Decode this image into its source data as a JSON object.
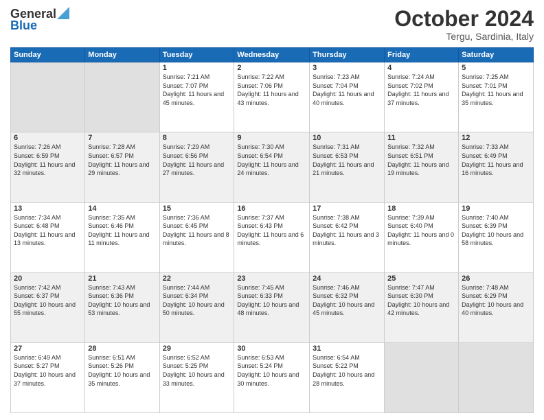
{
  "header": {
    "logo_general": "General",
    "logo_blue": "Blue",
    "month_title": "October 2024",
    "subtitle": "Tergu, Sardinia, Italy"
  },
  "days_of_week": [
    "Sunday",
    "Monday",
    "Tuesday",
    "Wednesday",
    "Thursday",
    "Friday",
    "Saturday"
  ],
  "weeks": [
    [
      {
        "day": "",
        "info": ""
      },
      {
        "day": "",
        "info": ""
      },
      {
        "day": "1",
        "info": "Sunrise: 7:21 AM\nSunset: 7:07 PM\nDaylight: 11 hours and 45 minutes."
      },
      {
        "day": "2",
        "info": "Sunrise: 7:22 AM\nSunset: 7:06 PM\nDaylight: 11 hours and 43 minutes."
      },
      {
        "day": "3",
        "info": "Sunrise: 7:23 AM\nSunset: 7:04 PM\nDaylight: 11 hours and 40 minutes."
      },
      {
        "day": "4",
        "info": "Sunrise: 7:24 AM\nSunset: 7:02 PM\nDaylight: 11 hours and 37 minutes."
      },
      {
        "day": "5",
        "info": "Sunrise: 7:25 AM\nSunset: 7:01 PM\nDaylight: 11 hours and 35 minutes."
      }
    ],
    [
      {
        "day": "6",
        "info": "Sunrise: 7:26 AM\nSunset: 6:59 PM\nDaylight: 11 hours and 32 minutes."
      },
      {
        "day": "7",
        "info": "Sunrise: 7:28 AM\nSunset: 6:57 PM\nDaylight: 11 hours and 29 minutes."
      },
      {
        "day": "8",
        "info": "Sunrise: 7:29 AM\nSunset: 6:56 PM\nDaylight: 11 hours and 27 minutes."
      },
      {
        "day": "9",
        "info": "Sunrise: 7:30 AM\nSunset: 6:54 PM\nDaylight: 11 hours and 24 minutes."
      },
      {
        "day": "10",
        "info": "Sunrise: 7:31 AM\nSunset: 6:53 PM\nDaylight: 11 hours and 21 minutes."
      },
      {
        "day": "11",
        "info": "Sunrise: 7:32 AM\nSunset: 6:51 PM\nDaylight: 11 hours and 19 minutes."
      },
      {
        "day": "12",
        "info": "Sunrise: 7:33 AM\nSunset: 6:49 PM\nDaylight: 11 hours and 16 minutes."
      }
    ],
    [
      {
        "day": "13",
        "info": "Sunrise: 7:34 AM\nSunset: 6:48 PM\nDaylight: 11 hours and 13 minutes."
      },
      {
        "day": "14",
        "info": "Sunrise: 7:35 AM\nSunset: 6:46 PM\nDaylight: 11 hours and 11 minutes."
      },
      {
        "day": "15",
        "info": "Sunrise: 7:36 AM\nSunset: 6:45 PM\nDaylight: 11 hours and 8 minutes."
      },
      {
        "day": "16",
        "info": "Sunrise: 7:37 AM\nSunset: 6:43 PM\nDaylight: 11 hours and 6 minutes."
      },
      {
        "day": "17",
        "info": "Sunrise: 7:38 AM\nSunset: 6:42 PM\nDaylight: 11 hours and 3 minutes."
      },
      {
        "day": "18",
        "info": "Sunrise: 7:39 AM\nSunset: 6:40 PM\nDaylight: 11 hours and 0 minutes."
      },
      {
        "day": "19",
        "info": "Sunrise: 7:40 AM\nSunset: 6:39 PM\nDaylight: 10 hours and 58 minutes."
      }
    ],
    [
      {
        "day": "20",
        "info": "Sunrise: 7:42 AM\nSunset: 6:37 PM\nDaylight: 10 hours and 55 minutes."
      },
      {
        "day": "21",
        "info": "Sunrise: 7:43 AM\nSunset: 6:36 PM\nDaylight: 10 hours and 53 minutes."
      },
      {
        "day": "22",
        "info": "Sunrise: 7:44 AM\nSunset: 6:34 PM\nDaylight: 10 hours and 50 minutes."
      },
      {
        "day": "23",
        "info": "Sunrise: 7:45 AM\nSunset: 6:33 PM\nDaylight: 10 hours and 48 minutes."
      },
      {
        "day": "24",
        "info": "Sunrise: 7:46 AM\nSunset: 6:32 PM\nDaylight: 10 hours and 45 minutes."
      },
      {
        "day": "25",
        "info": "Sunrise: 7:47 AM\nSunset: 6:30 PM\nDaylight: 10 hours and 42 minutes."
      },
      {
        "day": "26",
        "info": "Sunrise: 7:48 AM\nSunset: 6:29 PM\nDaylight: 10 hours and 40 minutes."
      }
    ],
    [
      {
        "day": "27",
        "info": "Sunrise: 6:49 AM\nSunset: 5:27 PM\nDaylight: 10 hours and 37 minutes."
      },
      {
        "day": "28",
        "info": "Sunrise: 6:51 AM\nSunset: 5:26 PM\nDaylight: 10 hours and 35 minutes."
      },
      {
        "day": "29",
        "info": "Sunrise: 6:52 AM\nSunset: 5:25 PM\nDaylight: 10 hours and 33 minutes."
      },
      {
        "day": "30",
        "info": "Sunrise: 6:53 AM\nSunset: 5:24 PM\nDaylight: 10 hours and 30 minutes."
      },
      {
        "day": "31",
        "info": "Sunrise: 6:54 AM\nSunset: 5:22 PM\nDaylight: 10 hours and 28 minutes."
      },
      {
        "day": "",
        "info": ""
      },
      {
        "day": "",
        "info": ""
      }
    ]
  ]
}
